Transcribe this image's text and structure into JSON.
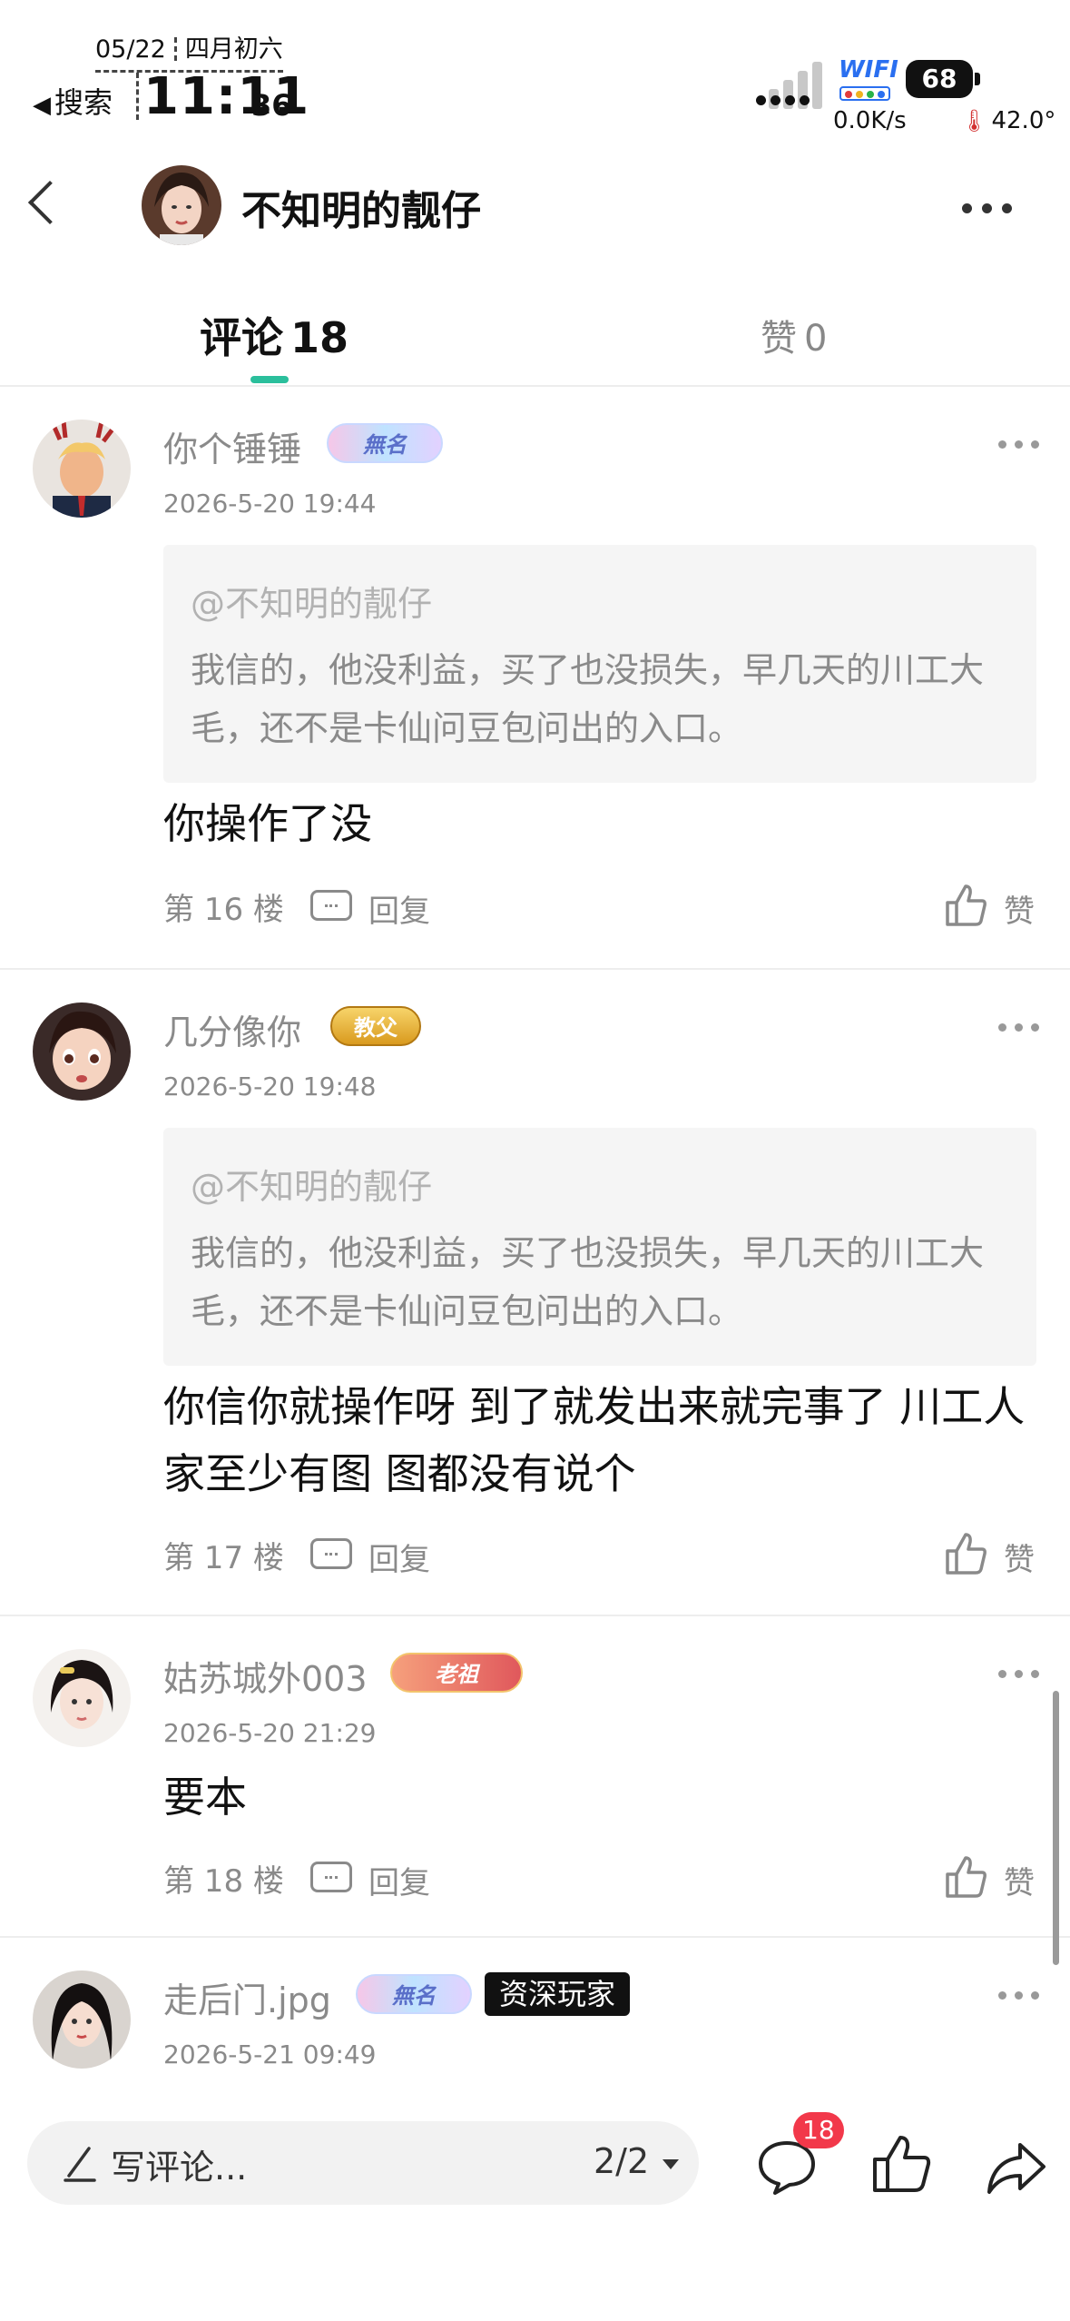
{
  "status_bar": {
    "date": "05/22",
    "lunar_date": "四月初六",
    "back_app": "搜索",
    "time_hm": "11:11",
    "time_s": "36",
    "wifi_label": "WIFI",
    "battery": "68",
    "net_speed": "0.0K/s",
    "temperature": "42.0°"
  },
  "header": {
    "title": "不知明的靓仔"
  },
  "tabs": {
    "comments_label": "评论",
    "comments_count": "18",
    "likes_label": "赞",
    "likes_count": "0"
  },
  "comments": [
    {
      "username": "你个锤锤",
      "badge": "無名",
      "time": "2026-5-20 19:44",
      "quote_user": "@不知明的靓仔",
      "quote_text": "我信的，他没利益，买了也没损失，早几天的川工大毛，还不是卡仙问豆包问出的入口。",
      "text": "你操作了没",
      "floor": "第 16 楼",
      "reply_label": "回复",
      "like_label": "赞"
    },
    {
      "username": "几分像你",
      "badge": "教父",
      "time": "2026-5-20 19:48",
      "quote_user": "@不知明的靓仔",
      "quote_text": "我信的，他没利益，买了也没损失，早几天的川工大毛，还不是卡仙问豆包问出的入口。",
      "text": "你信你就操作呀 到了就发出来就完事了 川工人家至少有图 图都没有说个",
      "floor": "第 17 楼",
      "reply_label": "回复",
      "like_label": "赞"
    },
    {
      "username": "姑苏城外003",
      "badge": "老祖",
      "time": "2026-5-20 21:29",
      "text": "要本",
      "floor": "第 18 楼",
      "reply_label": "回复",
      "like_label": "赞"
    },
    {
      "username": "走后门.jpg",
      "badge": "無名",
      "tag": "资深玩家",
      "time": "2026-5-21 09:49"
    }
  ],
  "bottom_bar": {
    "input_placeholder": "写评论...",
    "page_indicator": "2/2",
    "comment_count": "18"
  },
  "colors": {
    "tab_indicator": "#2bbf9c",
    "badge_red": "#f2384a",
    "wifi_blue": "#2a6ff0"
  }
}
